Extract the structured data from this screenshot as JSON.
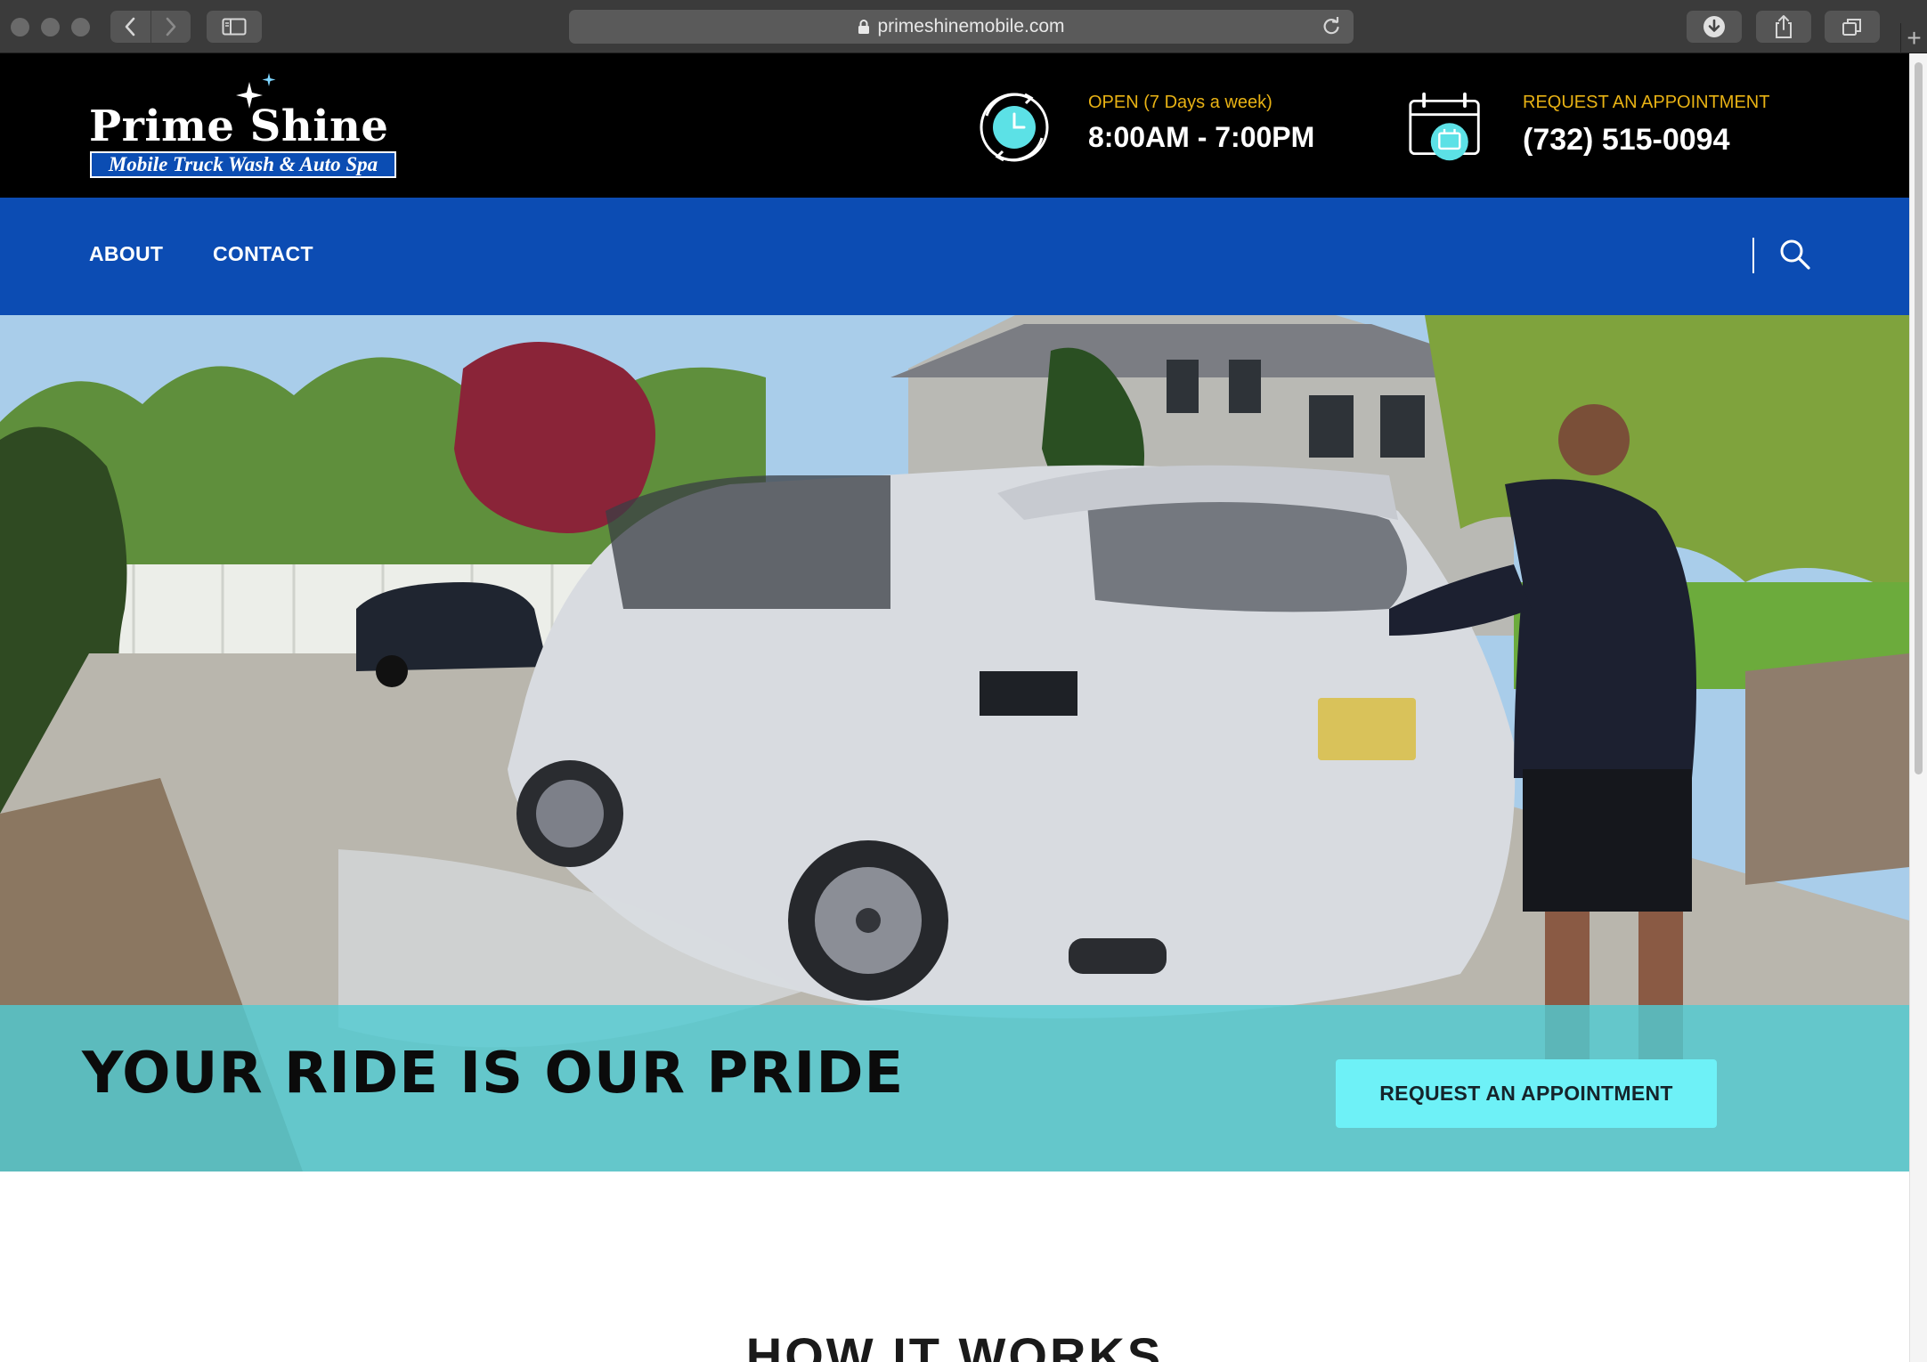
{
  "browser": {
    "url": "primeshinemobile.com"
  },
  "logo": {
    "title": "Prime Shine",
    "subtitle": "Mobile Truck Wash & Auto Spa"
  },
  "header": {
    "hours_label": "OPEN (7 Days a week)",
    "hours_value": "8:00AM - 7:00PM",
    "appointment_label": "REQUEST AN APPOINTMENT",
    "phone": "(732) 515-0094"
  },
  "nav": {
    "items": [
      {
        "label": "ABOUT"
      },
      {
        "label": "CONTACT"
      }
    ]
  },
  "hero": {
    "title": "YOUR RIDE IS OUR PRIDE",
    "cta_label": "REQUEST AN APPOINTMENT"
  },
  "section": {
    "title": "HOW IT WORKS"
  },
  "colors": {
    "header_bg": "#000000",
    "nav_bg": "#0c4cb3",
    "accent_gold": "#e8b214",
    "band_teal": "#52cad2",
    "cta_bg": "#6ef1f7",
    "icon_cyan": "#5ce1e6"
  },
  "icons": [
    "lock-icon",
    "reload-icon",
    "back-icon",
    "forward-icon",
    "sidebar-icon",
    "download-icon",
    "share-icon",
    "tabs-icon",
    "clock-icon",
    "calendar-icon",
    "search-icon"
  ]
}
